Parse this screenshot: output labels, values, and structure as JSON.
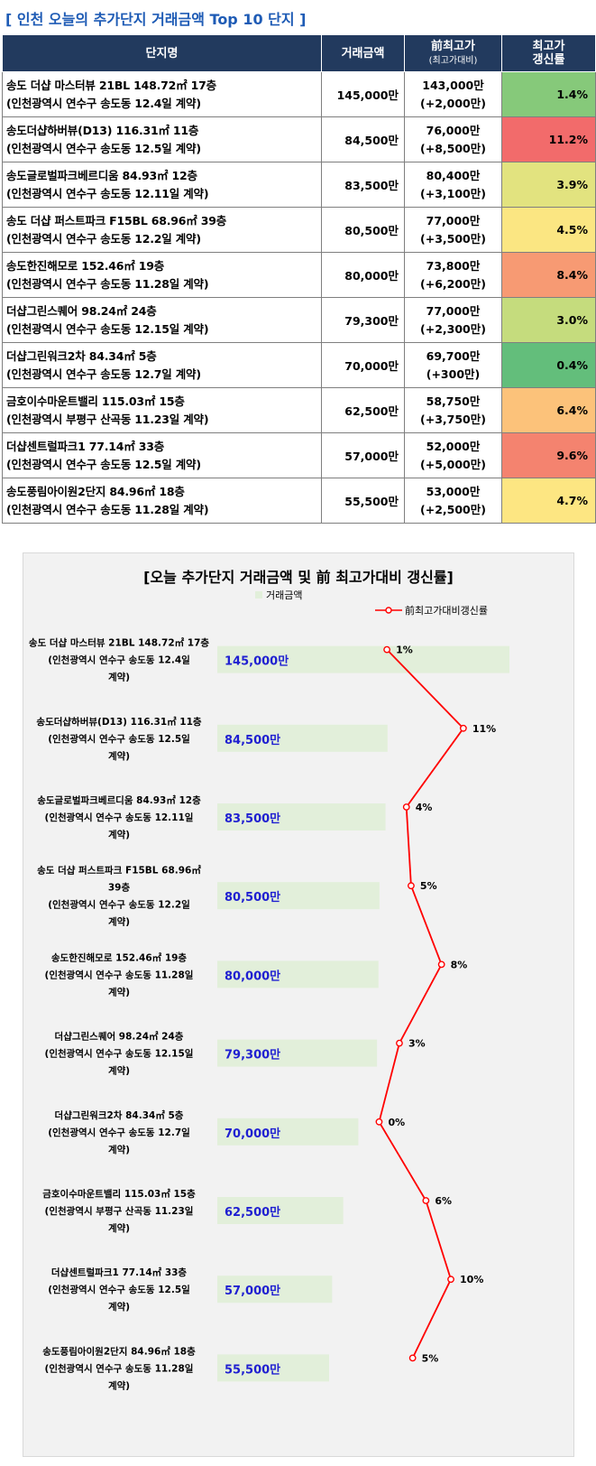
{
  "page_title": "[ 인천 오늘의 추가단지 거래금액 Top 10 단지 ]",
  "table": {
    "headers": {
      "name": "단지명",
      "price": "거래금액",
      "prev": "前최고가",
      "prev_sub": "(최고가대비)",
      "rate1": "최고가",
      "rate2": "갱신률"
    },
    "rows": [
      {
        "name1": "송도 더샵 마스터뷰 21BL 148.72㎡ 17층",
        "name2": "(인천광역시 연수구 송도동 12.4일 계약)",
        "price": "145,000만",
        "prev": "143,000만",
        "prev_diff": "(+2,000만)",
        "rate": "1.4%",
        "color": "#86c97a"
      },
      {
        "name1": "송도더샵하버뷰(D13) 116.31㎡ 11층",
        "name2": "(인천광역시 연수구 송도동 12.5일 계약)",
        "price": "84,500만",
        "prev": "76,000만",
        "prev_diff": "(+8,500만)",
        "rate": "11.2%",
        "color": "#f26b6b"
      },
      {
        "name1": "송도글로벌파크베르디움 84.93㎡ 12층",
        "name2": "(인천광역시 연수구 송도동 12.11일 계약)",
        "price": "83,500만",
        "prev": "80,400만",
        "prev_diff": "(+3,100만)",
        "rate": "3.9%",
        "color": "#e2e37f"
      },
      {
        "name1": "송도 더샵 퍼스트파크 F15BL 68.96㎡ 39층",
        "name2": "(인천광역시 연수구 송도동 12.2일 계약)",
        "price": "80,500만",
        "prev": "77,000만",
        "prev_diff": "(+3,500만)",
        "rate": "4.5%",
        "color": "#fbe682"
      },
      {
        "name1": "송도한진해모로 152.46㎡ 19층",
        "name2": "(인천광역시 연수구 송도동 11.28일 계약)",
        "price": "80,000만",
        "prev": "73,800만",
        "prev_diff": "(+6,200만)",
        "rate": "8.4%",
        "color": "#f79a73"
      },
      {
        "name1": "더샵그린스퀘어 98.24㎡ 24층",
        "name2": "(인천광역시 연수구 송도동 12.15일 계약)",
        "price": "79,300만",
        "prev": "77,000만",
        "prev_diff": "(+2,300만)",
        "rate": "3.0%",
        "color": "#c5dc7d"
      },
      {
        "name1": "더샵그린워크2차 84.34㎡ 5층",
        "name2": "(인천광역시 연수구 송도동 12.7일 계약)",
        "price": "70,000만",
        "prev": "69,700만",
        "prev_diff": "(+300만)",
        "rate": "0.4%",
        "color": "#63be7b"
      },
      {
        "name1": "금호이수마운트밸리 115.03㎡ 15층",
        "name2": "(인천광역시 부평구 산곡동 11.23일 계약)",
        "price": "62,500만",
        "prev": "58,750만",
        "prev_diff": "(+3,750만)",
        "rate": "6.4%",
        "color": "#fcc27a"
      },
      {
        "name1": "더샵센트럴파크1 77.14㎡ 33층",
        "name2": "(인천광역시 연수구 송도동 12.5일 계약)",
        "price": "57,000만",
        "prev": "52,000만",
        "prev_diff": "(+5,000만)",
        "rate": "9.6%",
        "color": "#f4836f"
      },
      {
        "name1": "송도풍림아이원2단지 84.96㎡ 18층",
        "name2": "(인천광역시 연수구 송도동 11.28일 계약)",
        "price": "55,500만",
        "prev": "53,000만",
        "prev_diff": "(+2,500만)",
        "rate": "4.7%",
        "color": "#fde682"
      }
    ]
  },
  "chart_data": {
    "type": "bar",
    "title": "[오늘 추가단지 거래금액  및 前 최고가대비 갱신률]",
    "categories": [
      [
        "송도 더샵 마스터뷰 21BL 148.72㎡ 17층",
        "(인천광역시 연수구 송도동 12.4일",
        "계약)"
      ],
      [
        "송도더샵하버뷰(D13) 116.31㎡ 11층",
        "(인천광역시 연수구 송도동 12.5일",
        "계약)"
      ],
      [
        "송도글로벌파크베르디움 84.93㎡ 12층",
        "(인천광역시 연수구 송도동 12.11일",
        "계약)"
      ],
      [
        "송도 더샵 퍼스트파크 F15BL 68.96㎡",
        "39층",
        "(인천광역시 연수구 송도동 12.2일",
        "계약)"
      ],
      [
        "송도한진해모로 152.46㎡ 19층",
        "(인천광역시 연수구 송도동 11.28일",
        "계약)"
      ],
      [
        "더샵그린스퀘어 98.24㎡ 24층",
        "(인천광역시 연수구 송도동 12.15일",
        "계약)"
      ],
      [
        "더샵그린워크2차 84.34㎡ 5층",
        "(인천광역시 연수구 송도동 12.7일",
        "계약)"
      ],
      [
        "금호이수마운트밸리 115.03㎡ 15층",
        "(인천광역시 부평구 산곡동 11.23일",
        "계약)"
      ],
      [
        "더샵센트럴파크1 77.14㎡ 33층",
        "(인천광역시 연수구 송도동 12.5일",
        "계약)"
      ],
      [
        "송도풍림아이원2단지 84.96㎡ 18층",
        "(인천광역시 연수구 송도동 11.28일",
        "계약)"
      ]
    ],
    "series": [
      {
        "name": "거래금액",
        "type": "bar",
        "color": "#e2efda",
        "values": [
          145000,
          84500,
          83500,
          80500,
          80000,
          79300,
          70000,
          62500,
          57000,
          55500
        ],
        "labels": [
          "145,000만",
          "84,500만",
          "83,500만",
          "80,500만",
          "80,000만",
          "79,300만",
          "70,000만",
          "62,500만",
          "57,000만",
          "55,500만"
        ],
        "label_color": "#1f1fd1"
      },
      {
        "name": "前최고가대비갱신률",
        "type": "line",
        "color": "#ff0000",
        "values": [
          1.4,
          11.2,
          3.9,
          4.5,
          8.4,
          3.0,
          0.4,
          6.4,
          9.6,
          4.7
        ],
        "labels": [
          "1%",
          "11%",
          "4%",
          "5%",
          "8%",
          "3%",
          "0%",
          "6%",
          "10%",
          "5%"
        ]
      }
    ],
    "legend_position": "top",
    "grid": false
  }
}
